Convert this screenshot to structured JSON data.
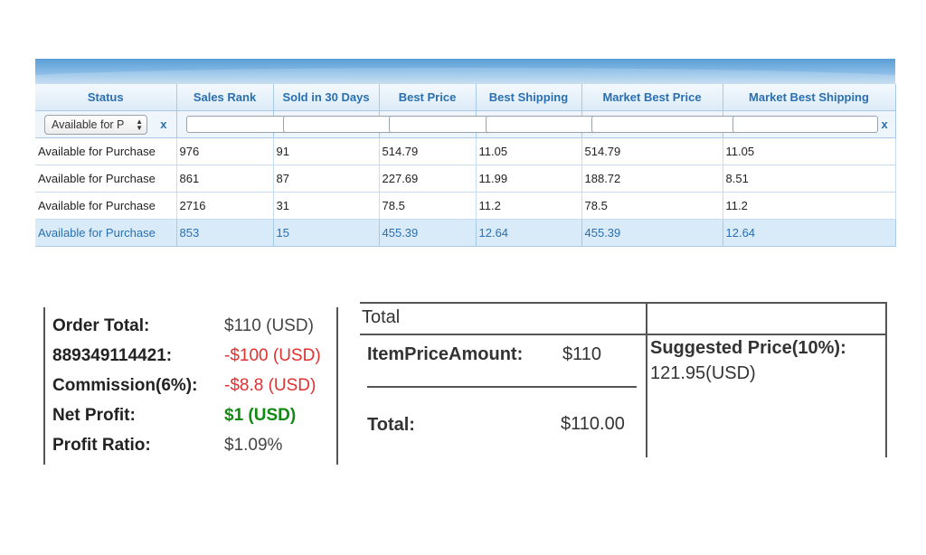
{
  "grid": {
    "columns": [
      "Status",
      "Sales Rank",
      "Sold in 30 Days",
      "Best Price",
      "Best Shipping",
      "Market Best Price",
      "Market Best Shipping"
    ],
    "filter": {
      "status_selected": "Available for P",
      "clear_label": "x"
    },
    "rows": [
      [
        "Available for Purchase",
        "976",
        "91",
        "514.79",
        "11.05",
        "514.79",
        "11.05"
      ],
      [
        "Available for Purchase",
        "861",
        "87",
        "227.69",
        "11.99",
        "188.72",
        "8.51"
      ],
      [
        "Available for Purchase",
        "2716",
        "31",
        "78.5",
        "11.2",
        "78.5",
        "11.2"
      ],
      [
        "Available for Purchase",
        "853",
        "15",
        "455.39",
        "12.64",
        "455.39",
        "12.64"
      ]
    ]
  },
  "order_summary": {
    "order_total_label": "Order Total:",
    "order_total_value": "$110 (USD)",
    "item_label": "889349114421:",
    "item_value": "-$100 (USD)",
    "commission_label": "Commission(6%):",
    "commission_value": "-$8.8 (USD)",
    "net_profit_label": "Net Profit:",
    "net_profit_value": "$1 (USD)",
    "profit_ratio_label": "Profit Ratio:",
    "profit_ratio_value": "$1.09%"
  },
  "totals_panel": {
    "header": "Total",
    "item_price_label": "ItemPriceAmount:",
    "item_price_value": "$110",
    "total_label": "Total:",
    "total_value": "$110.00",
    "suggested_label": "Suggested Price(10%):",
    "suggested_value": "121.95(USD)"
  },
  "colors": {
    "header_text": "#2a6fb0",
    "negative": "#e03030",
    "positive": "#118a11",
    "selected_row": "#d9ebf8"
  }
}
